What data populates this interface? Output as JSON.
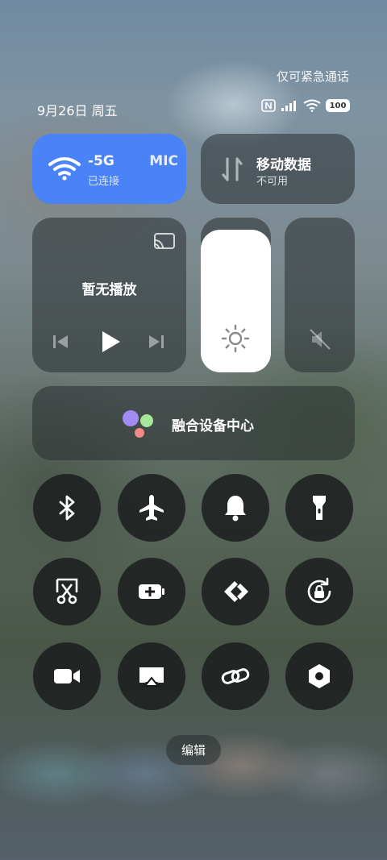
{
  "status": {
    "emergency_only": "仅可紧急通话",
    "date": "9月26日 周五",
    "battery": "100"
  },
  "wifi_tile": {
    "ssid_fragment_1": "-5G",
    "ssid_fragment_2": "MIC",
    "status": "已连接",
    "active": true
  },
  "mobile_tile": {
    "title": "移动数据",
    "status": "不可用"
  },
  "media_tile": {
    "title": "暂无播放"
  },
  "brightness": {
    "level": 0.92
  },
  "volume": {
    "level": 0.0,
    "muted": true
  },
  "device_center": {
    "label": "融合设备中心",
    "colors": [
      "#a18bf2",
      "#a6e79a",
      "#f28a83"
    ]
  },
  "toggles": [
    {
      "name": "bluetooth",
      "icon": "bluetooth-icon",
      "active": true
    },
    {
      "name": "airplane",
      "icon": "airplane-icon",
      "active": false
    },
    {
      "name": "ring",
      "icon": "bell-icon",
      "active": false
    },
    {
      "name": "flashlight",
      "icon": "flashlight-icon",
      "active": false
    },
    {
      "name": "screenshot",
      "icon": "scissors-icon",
      "active": false
    },
    {
      "name": "battery-saver",
      "icon": "battery-plus-icon",
      "active": false
    },
    {
      "name": "nearby-share",
      "icon": "share-arrows-icon",
      "active": false
    },
    {
      "name": "rotation-lock",
      "icon": "rotation-lock-icon",
      "active": true
    },
    {
      "name": "screen-record",
      "icon": "video-camera-icon",
      "active": false
    },
    {
      "name": "cast",
      "icon": "cast-screen-icon",
      "active": false
    },
    {
      "name": "link",
      "icon": "link-icon",
      "active": false
    },
    {
      "name": "settings",
      "icon": "hex-settings-icon",
      "active": false
    }
  ],
  "edit_button": {
    "label": "编辑"
  },
  "colors": {
    "accent": "#4a82f7",
    "dark_circle": "#191b1c"
  }
}
